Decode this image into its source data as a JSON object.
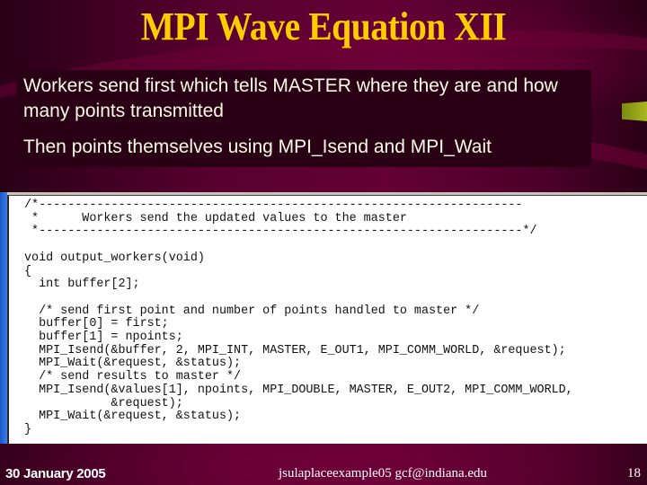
{
  "slide": {
    "title": "MPI Wave Equation XII",
    "bullets": [
      "Workers send first which tells MASTER where they are and how many points transmitted",
      "Then points themselves using MPI_Isend and MPI_Wait"
    ]
  },
  "code_window": {
    "lines": [
      "/*-------------------------------------------------------------------",
      " *      Workers send the updated values to the master",
      " *-------------------------------------------------------------------*/",
      "",
      "void output_workers(void)",
      "{",
      "  int buffer[2];",
      "",
      "  /* send first point and number of points handled to master */",
      "  buffer[0] = first;",
      "  buffer[1] = npoints;",
      "  MPI_Isend(&buffer, 2, MPI_INT, MASTER, E_OUT1, MPI_COMM_WORLD, &request);",
      "  MPI_Wait(&request, &status);",
      "  /* send results to master */",
      "  MPI_Isend(&values[1], npoints, MPI_DOUBLE, MASTER, E_OUT2, MPI_COMM_WORLD,",
      "            &request);",
      "  MPI_Wait(&request, &status);",
      "}"
    ]
  },
  "footer": {
    "date": "30 January 2005",
    "center": "jsulaplaceexample05  gcf@indiana.edu",
    "page_number": "18"
  },
  "colors": {
    "title": "#ffcc00",
    "background": "#5a0030",
    "textbox": "#2a0015",
    "accent": "#a8b820"
  }
}
